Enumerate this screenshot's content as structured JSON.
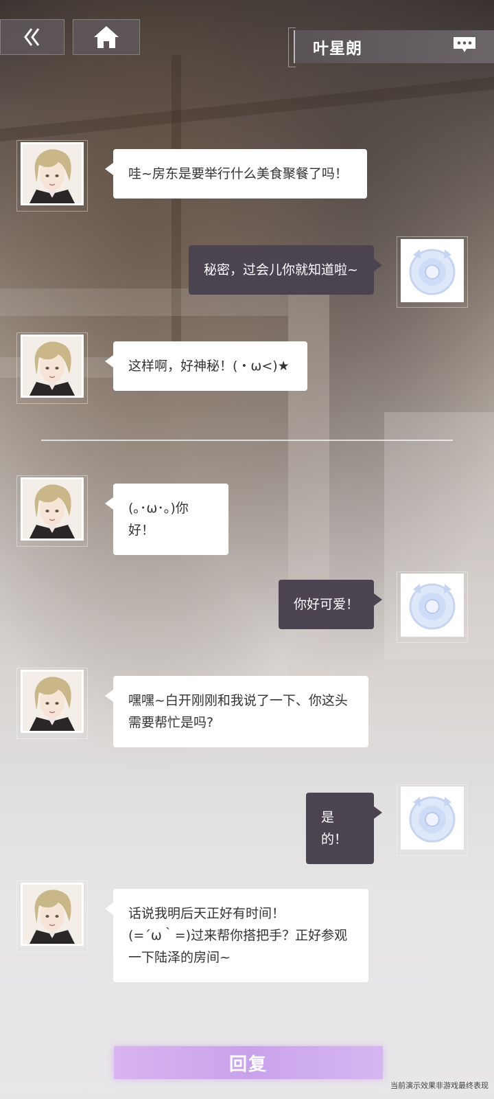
{
  "header": {
    "back_icon": "double-chevron-left-icon",
    "home_icon": "home-icon",
    "title": "叶星朗",
    "more_icon": "chat-more-icon"
  },
  "colors": {
    "left_bubble": "#ffffff",
    "right_bubble": "#4b4450",
    "reply_button": "#c9a2ec"
  },
  "messages": [
    {
      "side": "left",
      "text": "哇~房东是要举行什么美食聚餐了吗！"
    },
    {
      "side": "right",
      "text": "秘密，过会儿你就知道啦~"
    },
    {
      "side": "left",
      "text": "这样啊，好神秘！(・ω<)★"
    },
    {
      "side": "left",
      "text": "(｡･ω･｡)你好！"
    },
    {
      "side": "right",
      "text": "你好可爱！"
    },
    {
      "side": "left",
      "text": "嘿嘿~白开刚刚和我说了一下、你这头\n需要帮忙是吗?"
    },
    {
      "side": "right",
      "text": "是的！"
    },
    {
      "side": "left",
      "text": "话说我明后天正好有时间！\n(=´ω｀=)过来帮你搭把手？正好参观\n一下陆泽的房间~"
    }
  ],
  "reply_button": {
    "label": "回复"
  },
  "disclaimer": "当前演示效果非游戏最终表现"
}
